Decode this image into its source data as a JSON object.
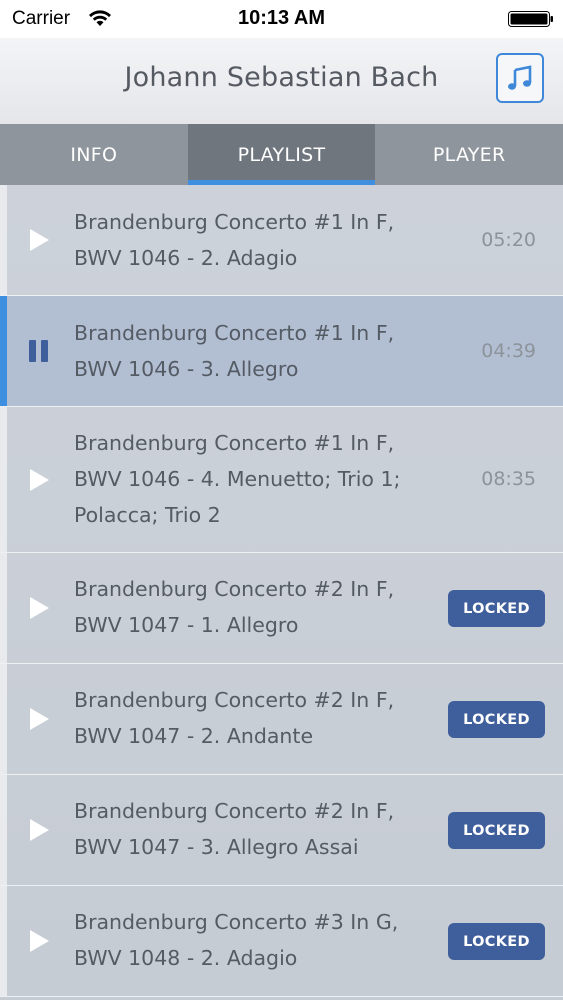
{
  "status_bar": {
    "carrier": "Carrier",
    "time": "10:13 AM",
    "wifi_icon": "wifi-icon",
    "battery_icon": "battery-icon"
  },
  "header": {
    "title": "Johann Sebastian Bach",
    "music_icon": "music-note-icon",
    "accent_color": "#3f88d9"
  },
  "tabs": [
    {
      "label": "INFO",
      "active": false
    },
    {
      "label": "PLAYLIST",
      "active": true
    },
    {
      "label": "PLAYER",
      "active": false
    }
  ],
  "playlist": {
    "locked_label": "LOCKED",
    "tracks": [
      {
        "line1": "Brandenburg Concerto #1 In F,",
        "line2": "BWV 1046 - 2. Adagio",
        "line3": "",
        "duration": "05:20",
        "state": "play"
      },
      {
        "line1": "Brandenburg Concerto #1 In F,",
        "line2": "BWV 1046 - 3. Allegro",
        "line3": "",
        "duration": "04:39",
        "state": "pause"
      },
      {
        "line1": "Brandenburg Concerto #1 In F,",
        "line2": "BWV 1046 - 4. Menuetto; Trio 1;",
        "line3": "Polacca; Trio 2",
        "duration": "08:35",
        "state": "play"
      },
      {
        "line1": "Brandenburg Concerto #2 In F,",
        "line2": "BWV 1047 - 1. Allegro",
        "line3": "",
        "duration": "",
        "state": "locked"
      },
      {
        "line1": "Brandenburg Concerto #2 In F,",
        "line2": "BWV 1047 - 2. Andante",
        "line3": "",
        "duration": "",
        "state": "locked"
      },
      {
        "line1": "Brandenburg Concerto #2 In F,",
        "line2": "BWV 1047 - 3. Allegro Assai",
        "line3": "",
        "duration": "",
        "state": "locked"
      },
      {
        "line1": "Brandenburg Concerto #3 In G,",
        "line2": "BWV 1048 - 2. Adagio",
        "line3": "",
        "duration": "",
        "state": "locked"
      }
    ]
  }
}
